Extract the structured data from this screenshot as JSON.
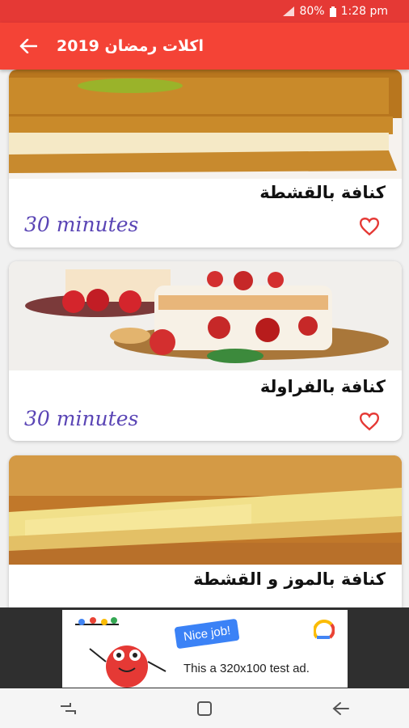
{
  "status_bar": {
    "battery": "80%",
    "time": "1:28 pm"
  },
  "app_bar": {
    "title": "اكلات رمضان 2019"
  },
  "recipes": [
    {
      "title": "كنافة بالقشطة",
      "duration": "30 minutes"
    },
    {
      "title": "كنافة بالفراولة",
      "duration": "30 minutes"
    },
    {
      "title": "كنافة بالموز و القشطة",
      "duration": ""
    }
  ],
  "ad": {
    "badge": "Nice job!",
    "text": "This a 320x100 test ad."
  },
  "colors": {
    "primary": "#f44336",
    "status": "#e53935",
    "time_text": "#5a45b5",
    "heart": "#e53935"
  }
}
